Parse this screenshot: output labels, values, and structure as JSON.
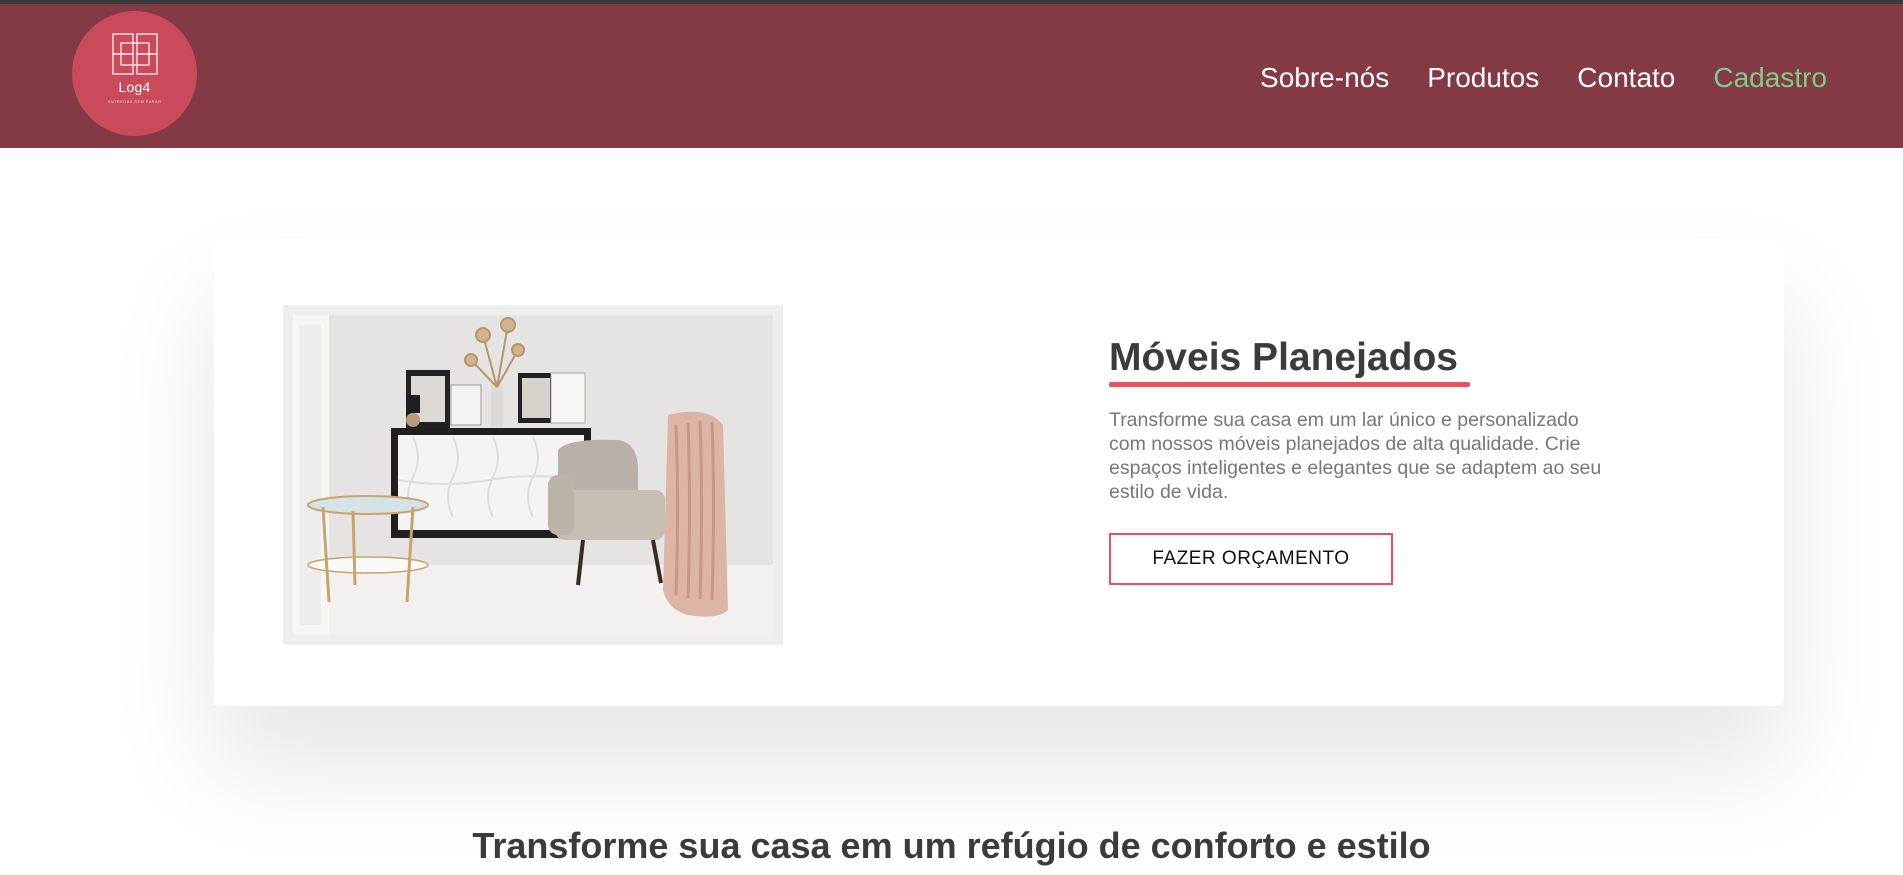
{
  "header": {
    "logo": {
      "name": "Log4",
      "tagline": "ENTREGAS SEM PARAR",
      "icon": "window-grid-icon"
    },
    "nav": [
      {
        "label": "Sobre-nós",
        "active": false
      },
      {
        "label": "Produtos",
        "active": false
      },
      {
        "label": "Contato",
        "active": false
      },
      {
        "label": "Cadastro",
        "active": true
      }
    ]
  },
  "hero": {
    "image_alt": "living-room-furniture-photo",
    "title": "Móveis Planejados",
    "description": "Transforme sua casa em um lar único e personalizado com nossos móveis planejados de alta qualidade. Crie espaços inteligentes e elegantes que se adaptem ao seu estilo de vida.",
    "button_label": "FAZER ORÇAMENTO"
  },
  "section": {
    "title": "Transforme sua casa em um refúgio de conforto e estilo"
  },
  "colors": {
    "header_bg": "#833a45",
    "logo_bg": "#c94a5a",
    "accent": "#e8525e",
    "nav_active": "#7ccf86",
    "heading": "#3b3b3b",
    "body_text": "#777777"
  }
}
